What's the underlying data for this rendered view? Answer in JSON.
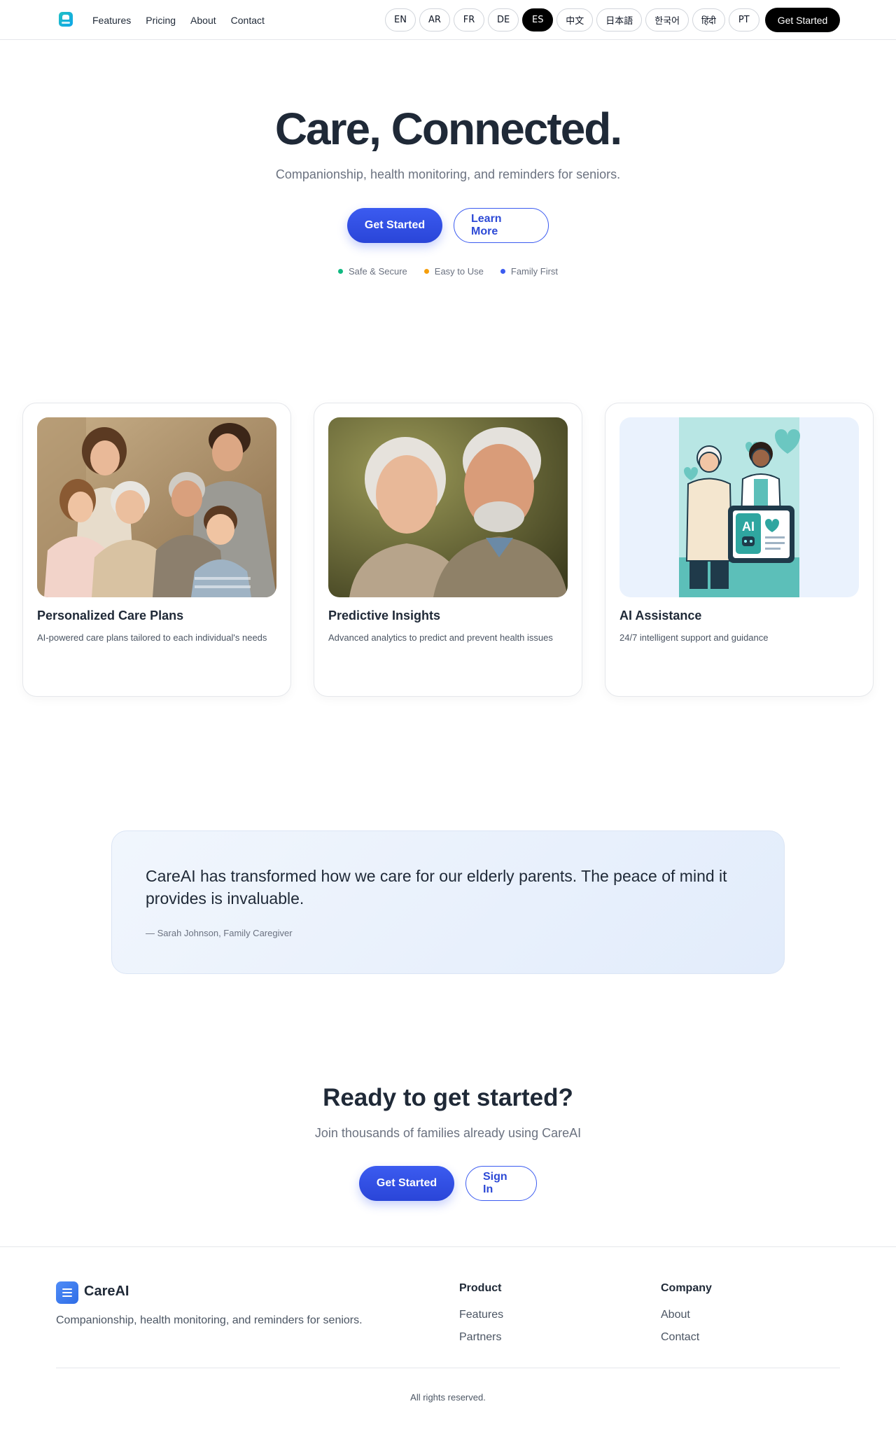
{
  "header": {
    "nav": [
      "Features",
      "Pricing",
      "About",
      "Contact"
    ],
    "languages": [
      "EN",
      "AR",
      "FR",
      "DE",
      "ES",
      "中文",
      "日本語",
      "한국어",
      "हिंदी",
      "PT"
    ],
    "active_language": "ES",
    "cta": "Get Started"
  },
  "hero": {
    "title": "Care, Connected.",
    "subtitle": "Companionship, health monitoring, and reminders for seniors.",
    "primary": "Get Started",
    "secondary": "Learn More",
    "badges": [
      {
        "label": "Safe & Secure",
        "color": "#10b981"
      },
      {
        "label": "Easy to Use",
        "color": "#f59e0b"
      },
      {
        "label": "Family First",
        "color": "#3b5bf0"
      }
    ]
  },
  "features": [
    {
      "title": "Personalized Care Plans",
      "desc": "AI-powered care plans tailored to each individual's needs",
      "image": "family-photo"
    },
    {
      "title": "Predictive Insights",
      "desc": "Advanced analytics to predict and prevent health issues",
      "image": "elderly-couple-photo"
    },
    {
      "title": "AI Assistance",
      "desc": "24/7 intelligent support and guidance",
      "image": "ai-doctor-illustration"
    }
  ],
  "ai_illustration": {
    "screen_text": "AI"
  },
  "testimonial": {
    "quote": "CareAI has transformed how we care for our elderly parents. The peace of mind it provides is invaluable.",
    "author": "— Sarah Johnson, Family Caregiver"
  },
  "cta": {
    "title": "Ready to get started?",
    "subtitle": "Join thousands of families already using CareAI",
    "primary": "Get Started",
    "secondary": "Sign In"
  },
  "footer": {
    "brand": "CareAI",
    "tagline": "Companionship, health monitoring, and reminders for seniors.",
    "product": {
      "heading": "Product",
      "links": [
        "Features",
        "Partners"
      ]
    },
    "company": {
      "heading": "Company",
      "links": [
        "About",
        "Contact"
      ]
    },
    "copyright": "All rights reserved."
  },
  "colors": {
    "accent": "#3b5bf0",
    "dark": "#000000",
    "text": "#1f2937"
  }
}
